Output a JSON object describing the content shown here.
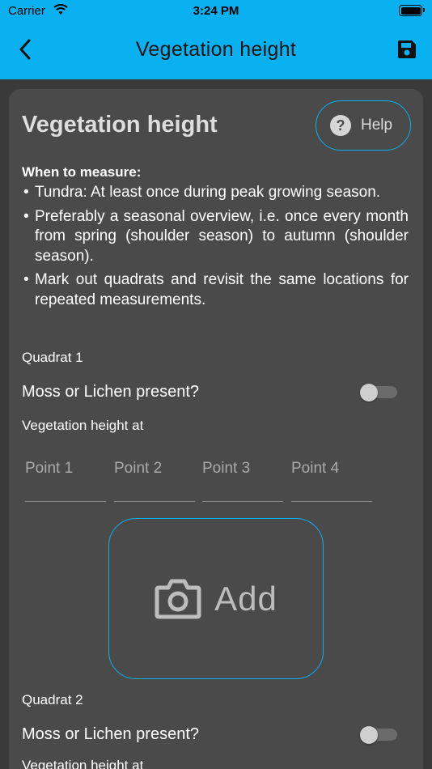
{
  "status_bar": {
    "carrier": "Carrier",
    "time": "3:24 PM"
  },
  "app_bar": {
    "title": "Vegetation height",
    "color": "#0ab1f0"
  },
  "card": {
    "title": "Vegetation height",
    "help_label": "Help",
    "when_heading": "When to measure:",
    "bullets": [
      "Tundra: At least once during peak growing season.",
      "Preferably a seasonal overview, i.e. once every month from spring (shoulder season) to autumn (shoulder season).",
      "Mark out quadrats and revisit the same locations for repeated measurements."
    ],
    "quadrats": [
      {
        "label": "Quadrat 1",
        "moss_label": "Moss or Lichen present?",
        "moss_present": false,
        "height_label": "Vegetation height at",
        "points": [
          "Point 1",
          "Point 2",
          "Point 3",
          "Point 4"
        ],
        "add_label": "Add"
      },
      {
        "label": "Quadrat 2",
        "moss_label": "Moss or Lichen present?",
        "moss_present": false,
        "height_label": "Vegetation height at"
      }
    ]
  }
}
